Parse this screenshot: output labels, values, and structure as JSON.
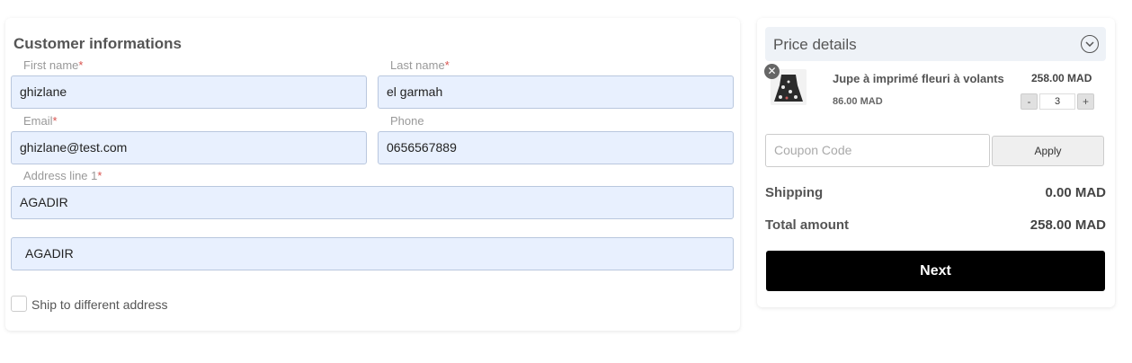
{
  "customer": {
    "title": "Customer informations",
    "first_name": {
      "label": "First name",
      "required": "*",
      "value": "ghizlane"
    },
    "last_name": {
      "label": "Last name",
      "required": "*",
      "value": "el garmah"
    },
    "email": {
      "label": "Email",
      "required": "*",
      "value": "ghizlane@test.com"
    },
    "phone": {
      "label": "Phone",
      "value": "0656567889"
    },
    "address1": {
      "label": "Address line 1",
      "required": "*",
      "value": "AGADIR"
    },
    "address2": {
      "value": "AGADIR"
    },
    "ship_different": {
      "label": "Ship to different address",
      "checked": false
    }
  },
  "price_details": {
    "title": "Price details",
    "item": {
      "name": "Jupe à imprimé fleuri à volants",
      "unit_price": "86.00 MAD",
      "total": "258.00 MAD",
      "qty_minus": "-",
      "qty": "3",
      "qty_plus": "+",
      "remove": "✕"
    },
    "coupon": {
      "placeholder": "Coupon Code",
      "button": "Apply"
    },
    "shipping": {
      "label": "Shipping",
      "value": "0.00 MAD"
    },
    "total": {
      "label": "Total amount",
      "value": "258.00 MAD"
    },
    "next_button": "Next"
  },
  "colors": {
    "input_bg": "#e8f0fe",
    "next_bg": "#000000",
    "required": "#d9534f"
  }
}
